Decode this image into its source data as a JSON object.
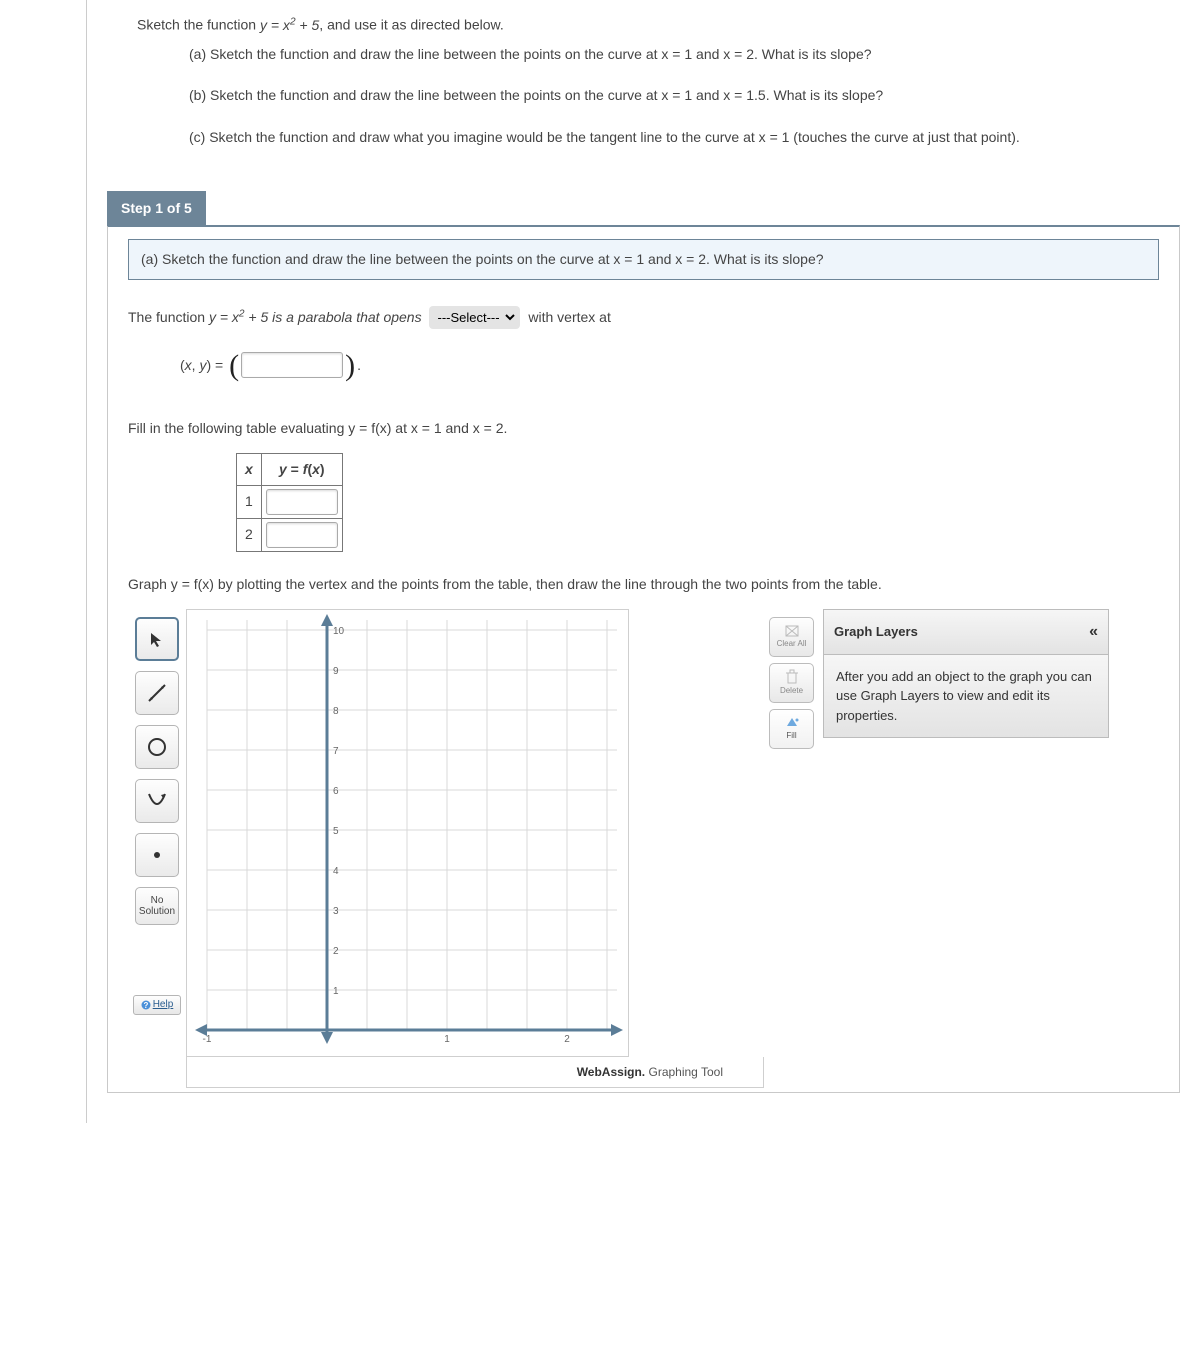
{
  "problem": {
    "intro_pre": "Sketch the function ",
    "intro_eq": "y = x",
    "intro_eq_sup": "2",
    "intro_eq_post": " + 5",
    "intro_tail": ", and use it as directed below.",
    "part_a": "(a) Sketch the function and draw the line between the points on the curve at x = 1 and x = 2. What is its slope?",
    "part_b": "(b) Sketch the function and draw the line between the points on the curve at x = 1 and x = 1.5. What is its slope?",
    "part_c": "(c) Sketch the function and draw what you imagine would be the tangent line to the curve at x = 1 (touches the curve at just that point)."
  },
  "step_header": "Step 1 of 5",
  "part_a_box": "(a) Sketch the function and draw the line between the points on the curve at x = 1 and x = 2. What is its slope?",
  "step": {
    "line1_pre": "The function ",
    "line1_eq": "y = x",
    "line1_sup": "2",
    "line1_post": " + 5 is a parabola that opens ",
    "line1_tail": " with vertex at",
    "vertex_label": "(x, y) = ",
    "select_placeholder": "---Select---",
    "fill_text": "Fill in the following table evaluating y = f(x) at x = 1 and x = 2.",
    "graph_text": "Graph y = f(x) by plotting the vertex and the points from the table, then draw the line through the two points from the table."
  },
  "table": {
    "h1": "x",
    "h2": "y = f(x)",
    "r1": "1",
    "r2": "2"
  },
  "tools": {
    "no_solution": "No Solution",
    "help": "Help",
    "clear_all": "Clear All",
    "delete": "Delete",
    "fill": "Fill"
  },
  "layers": {
    "title": "Graph Layers",
    "body": "After you add an object to the graph you can use Graph Layers to view and edit its properties."
  },
  "footer_brand": "WebAssign.",
  "footer_tool": " Graphing Tool",
  "chart_data": {
    "type": "scatter",
    "title": "",
    "xlabel": "",
    "ylabel": "",
    "xlim": [
      -1,
      2.5
    ],
    "ylim": [
      0,
      10
    ],
    "xticks": [
      -1,
      1,
      2
    ],
    "yticks": [
      1,
      2,
      3,
      4,
      5,
      6,
      7,
      8,
      9,
      10
    ],
    "grid": true,
    "series": []
  }
}
